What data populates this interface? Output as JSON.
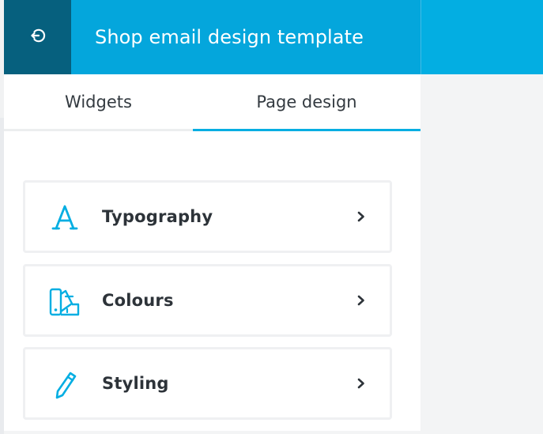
{
  "header": {
    "title": "Shop email design template",
    "back_icon": "back-arrow-circle-icon",
    "accent_color": "#03aee2",
    "back_color": "#06607e"
  },
  "tabs": [
    {
      "label": "Widgets",
      "active": false
    },
    {
      "label": "Page design",
      "active": true
    }
  ],
  "menu": [
    {
      "label": "Typography",
      "icon": "typography-icon"
    },
    {
      "label": "Colours",
      "icon": "colour-swatches-icon"
    },
    {
      "label": "Styling",
      "icon": "pencil-icon"
    }
  ]
}
